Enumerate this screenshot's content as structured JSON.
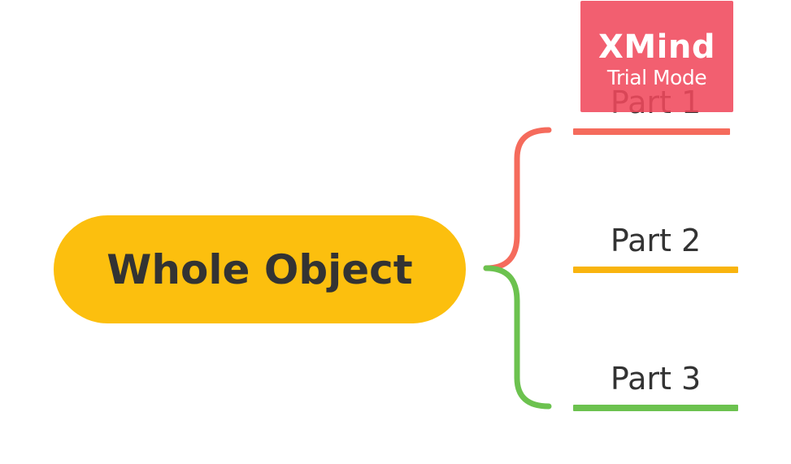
{
  "central_topic": {
    "label": "Whole Object",
    "color": "#FCBF0E",
    "text_color": "#333333"
  },
  "subtopics": [
    {
      "label": "Part 1",
      "color": "#F56B5C"
    },
    {
      "label": "Part 2",
      "color": "#F9B40E"
    },
    {
      "label": "Part 3",
      "color": "#6CC24F"
    }
  ],
  "watermark": {
    "title": "XMind",
    "subtitle": "Trial Mode",
    "color": "#F0495C"
  },
  "background": "#FFFFFF"
}
